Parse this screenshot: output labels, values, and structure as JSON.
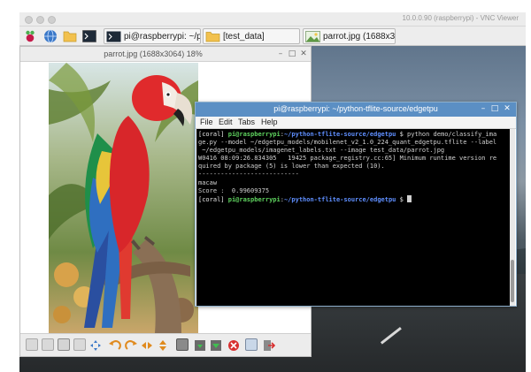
{
  "vnc": {
    "title": "10.0.0.90 (raspberrypi) - VNC Viewer"
  },
  "taskbar": {
    "tasks": [
      {
        "label": "pi@raspberrypi: ~/pyt..."
      },
      {
        "label": "[test_data]"
      },
      {
        "label": "parrot.jpg (1688x306..."
      }
    ],
    "launcher_icons": [
      "raspberry-menu-icon",
      "web-browser-icon",
      "file-manager-icon",
      "terminal-icon"
    ]
  },
  "viewer": {
    "title": "parrot.jpg (1688x3064) 18%",
    "toolbar_icons": [
      "previous-icon",
      "next-icon",
      "fit-window-icon",
      "original-size-icon",
      "fullscreen-icon",
      "rotate-left-icon",
      "rotate-right-icon",
      "flip-horizontal-icon",
      "flip-vertical-icon",
      "open-file-icon",
      "save-file-icon",
      "save-as-icon",
      "delete-icon",
      "preferences-icon",
      "exit-icon"
    ]
  },
  "terminal": {
    "title": "pi@raspberrypi: ~/python-tflite-source/edgetpu",
    "menu": [
      "File",
      "Edit",
      "Tabs",
      "Help"
    ],
    "prompt": {
      "env": "[coral]",
      "user_host": "pi@raspberrypi",
      "sep": ":",
      "path": "~/python-tflite-source/edgetpu",
      "symbol": "$"
    },
    "command_lines": [
      " python demo/classify_ima",
      "ge.py --model ~/edgetpu_models/mobilenet_v2_1.0_224_quant_edgetpu.tflite --label",
      " ~/edgetpu_models/imagenet_labels.txt --image test_data/parrot.jpg"
    ],
    "output_lines": [
      "W0416 08:09:26.834305   19425 package_registry.cc:65] Minimum runtime version re",
      "quired by package (5) is lower than expected (10).",
      "---------------------------",
      "macaw",
      "Score :  0.99609375"
    ]
  },
  "colors": {
    "terminal_titlebar": "#5b8fc4",
    "prompt_user": "#5fd35f",
    "prompt_path": "#5f8fff",
    "terminal_bg": "#000000"
  }
}
